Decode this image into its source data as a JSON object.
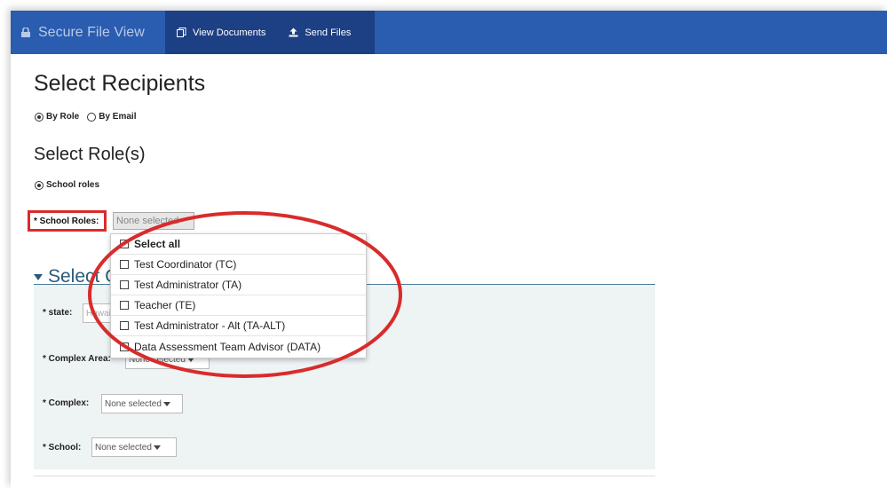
{
  "nav": {
    "brand": "Secure File View",
    "tabs": [
      {
        "label": "View Documents",
        "icon": "documents-icon"
      },
      {
        "label": "Send Files",
        "icon": "upload-icon"
      }
    ]
  },
  "page": {
    "title": "Select Recipients",
    "recipient_mode": {
      "options": [
        "By Role",
        "By Email"
      ],
      "selected": "By Role"
    },
    "roles_heading": "Select Role(s)",
    "role_scope": "School roles"
  },
  "school_roles": {
    "label": "* School Roles:",
    "value": "None selected",
    "options": [
      "Select all",
      "Test Coordinator (TC)",
      "Test Administrator (TA)",
      "Teacher (TE)",
      "Test Administrator - Alt (TA-ALT)",
      "Data Assessment Team Advisor (DATA)"
    ]
  },
  "location": {
    "heading": "Select Organization",
    "fields": [
      {
        "label": "* state:",
        "value": "Hawaii"
      },
      {
        "label": "* Complex Area:",
        "value": "None selected"
      },
      {
        "label": "* Complex:",
        "value": "None selected"
      },
      {
        "label": "* School:",
        "value": "None selected"
      }
    ]
  },
  "colors": {
    "navbar": "#2a5db0",
    "navtabs": "#1d3f83",
    "annotation": "#d92b2b",
    "panel": "#eef3f4"
  }
}
